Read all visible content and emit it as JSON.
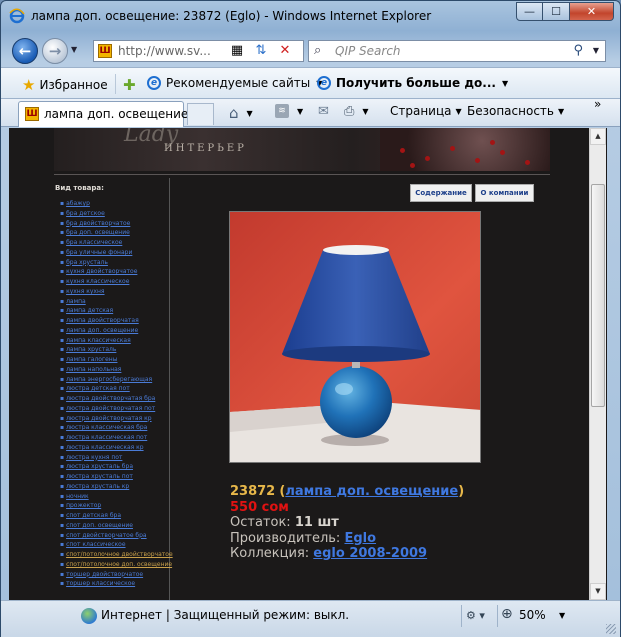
{
  "window": {
    "title": "лампа доп. освещение: 23872 (Eglo) - Windows Internet Explorer",
    "min_label": "—",
    "max_label": "☐",
    "close_label": "✕"
  },
  "address": {
    "url": "http://www.sv...",
    "search_placeholder": "QIP Search"
  },
  "favorites": {
    "favorites_label": "Избранное",
    "recommended_label": "Рекомендуемые сайты",
    "get_more_label": "Получить больше до..."
  },
  "tabs": [
    {
      "label": "лампа доп. освещение..."
    }
  ],
  "commandbar": {
    "page_label": "Страница",
    "security_label": "Безопасность",
    "overflow": "»"
  },
  "site": {
    "brand": "ИНТЕРЬЕР",
    "brand_swash": "Lady",
    "sidebar_heading": "Вид товара:",
    "categories": [
      "абажур",
      "бра детское",
      "бра двойстворчатое",
      "бра доп. освещение",
      "бра классическое",
      "бра уличные фонари",
      "бра хрусталь",
      "кухня двойстворчатое",
      "кухня классическое",
      "кухня кухня",
      "лампа",
      "лампа детская",
      "лампа двойстворчатая",
      "лампа доп. освещение",
      "лампа классическая",
      "лампа хрусталь",
      "лампа галогены",
      "лампа напольная",
      "лампа энергосберегающая",
      "люстра детская пот",
      "люстра двойстворчатая бра",
      "люстра двойстворчатая пот",
      "люстра двойстворчатая кр",
      "люстра классическая бра",
      "люстра классическая пот",
      "люстра классическая кр",
      "люстра кухня пот",
      "люстра хрусталь бра",
      "люстра хрусталь пот",
      "люстра хрусталь кр",
      "ночник",
      "прожектор",
      "спот детская бра",
      "спот доп. освещение",
      "спот двойстворчатое бра",
      "спот классическое",
      "спот/потолочное двойстворчатое",
      "спот/потолочное доп. освещение",
      "торшер двойстворчатое",
      "торшер классическое"
    ],
    "top_buttons": [
      "Содержание",
      "О компании"
    ]
  },
  "product": {
    "code": "23872",
    "category_link": "лампа доп. освещение",
    "price": "550 сом",
    "stock_label": "Остаток:",
    "stock_value": "11 шт",
    "maker_label": "Производитель:",
    "maker_link": "Eglo",
    "collection_label": "Коллекция:",
    "collection_link": "eglo 2008-2009"
  },
  "status": {
    "zone": "Интернет | Защищенный режим: выкл.",
    "zoom": "50%"
  }
}
